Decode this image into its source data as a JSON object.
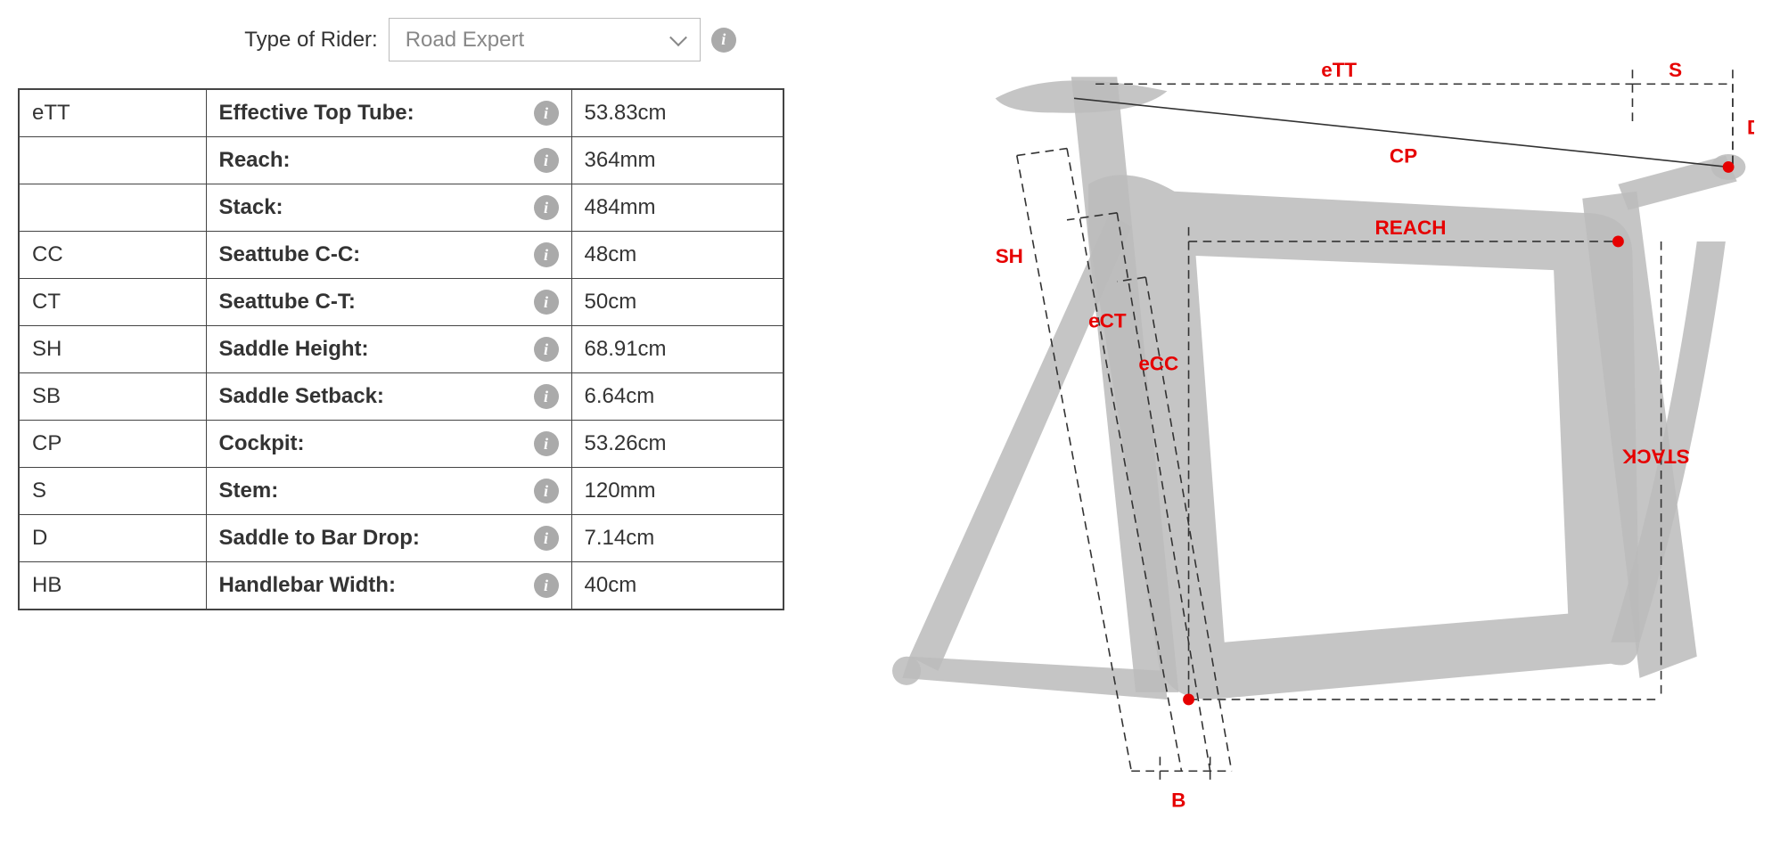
{
  "rider": {
    "label": "Type of Rider:",
    "selected": "Road Expert"
  },
  "rows": [
    {
      "abbr": "eTT",
      "label": "Effective Top Tube:",
      "value": "53.83cm"
    },
    {
      "abbr": "",
      "label": "Reach:",
      "value": "364mm"
    },
    {
      "abbr": "",
      "label": "Stack:",
      "value": "484mm"
    },
    {
      "abbr": "CC",
      "label": "Seattube C-C:",
      "value": "48cm"
    },
    {
      "abbr": "CT",
      "label": "Seattube C-T:",
      "value": "50cm"
    },
    {
      "abbr": "SH",
      "label": "Saddle Height:",
      "value": "68.91cm"
    },
    {
      "abbr": "SB",
      "label": "Saddle Setback:",
      "value": "6.64cm"
    },
    {
      "abbr": "CP",
      "label": "Cockpit:",
      "value": "53.26cm"
    },
    {
      "abbr": "S",
      "label": "Stem:",
      "value": "120mm"
    },
    {
      "abbr": "D",
      "label": "Saddle to Bar Drop:",
      "value": "7.14cm"
    },
    {
      "abbr": "HB",
      "label": "Handlebar Width:",
      "value": "40cm"
    }
  ],
  "diagram": {
    "labels": {
      "eTT": "eTT",
      "S": "S",
      "D": "D",
      "CP": "CP",
      "REACH": "REACH",
      "STACK": "STACK",
      "SH": "SH",
      "eCT": "eCT",
      "eCC": "eCC",
      "B": "B"
    }
  }
}
